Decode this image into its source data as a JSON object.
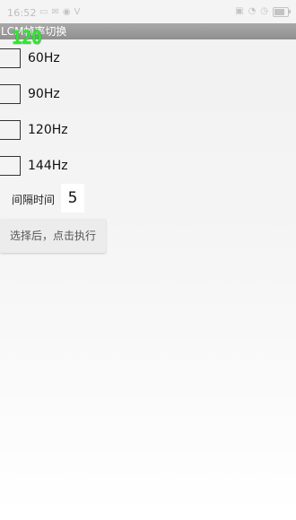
{
  "status_bar": {
    "time": "16:52",
    "left_icons": [
      "notification-icon",
      "mail-icon",
      "chat-icon",
      "v-icon"
    ],
    "right_icons": [
      "sim-icon",
      "wifi-icon",
      "alarm-icon",
      "battery-icon"
    ],
    "battery_level": 0.7
  },
  "app": {
    "title": "LCM帧率切换",
    "fps_overlay": "120"
  },
  "options": [
    {
      "label": "60Hz",
      "checked": false
    },
    {
      "label": "90Hz",
      "checked": false
    },
    {
      "label": "120Hz",
      "checked": false
    },
    {
      "label": "144Hz",
      "checked": false
    }
  ],
  "interval": {
    "label": "间隔时间",
    "value": "5"
  },
  "execute_button": {
    "label": "选择后，点击执行"
  }
}
